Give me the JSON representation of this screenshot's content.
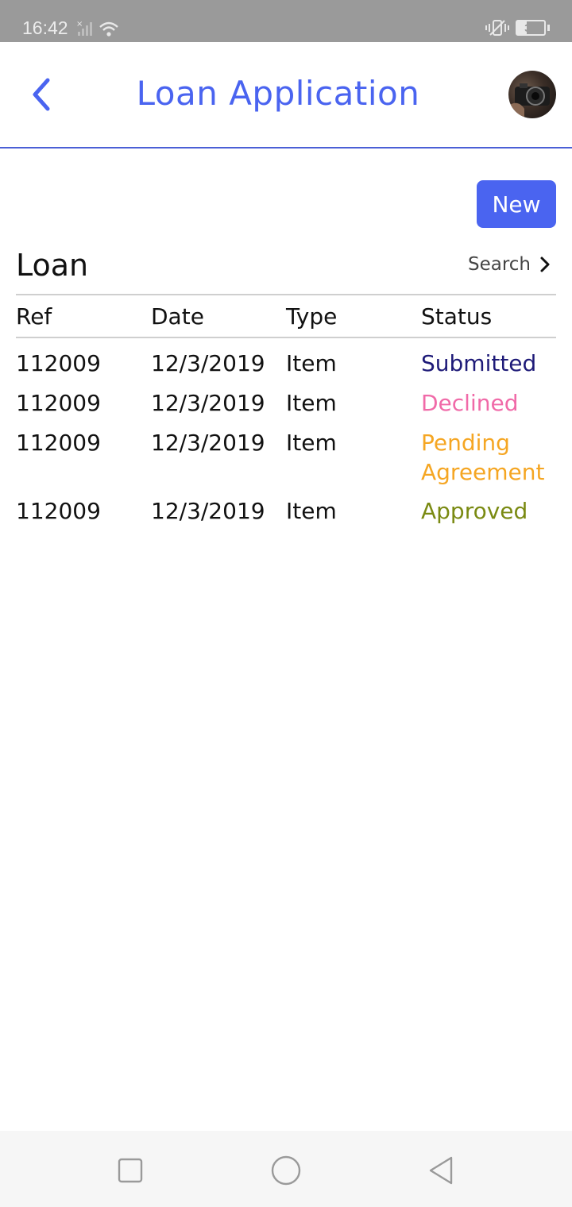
{
  "status_bar": {
    "time": "16:42",
    "battery_level": "34",
    "battery_percent": 34,
    "icons": [
      "signal-icon",
      "wifi-icon",
      "vibrate-icon",
      "battery-icon"
    ]
  },
  "header": {
    "title": "Loan Application",
    "back_icon": "chevron-left-icon",
    "avatar": "user-avatar-camera-photo"
  },
  "actions": {
    "new_label": "New"
  },
  "section": {
    "title": "Loan",
    "search_label": "Search"
  },
  "table": {
    "columns": [
      "Ref",
      "Date",
      "Type",
      "Status"
    ],
    "rows": [
      {
        "ref": "112009",
        "date": "12/3/2019",
        "type": "Item",
        "status": "Submitted"
      },
      {
        "ref": "112009",
        "date": "12/3/2019",
        "type": "Item",
        "status": "Declined"
      },
      {
        "ref": "112009",
        "date": "12/3/2019",
        "type": "Item",
        "status": "Pending Agreement"
      },
      {
        "ref": "112009",
        "date": "12/3/2019",
        "type": "Item",
        "status": "Approved"
      }
    ]
  },
  "colors": {
    "accent": "#4a64f0",
    "status_submitted": "#1e1a78",
    "status_declined": "#f06aa8",
    "status_pending": "#f5a623",
    "status_approved": "#7a8a12"
  },
  "nav": {
    "items": [
      "recents-square-icon",
      "home-circle-icon",
      "back-triangle-icon"
    ]
  }
}
